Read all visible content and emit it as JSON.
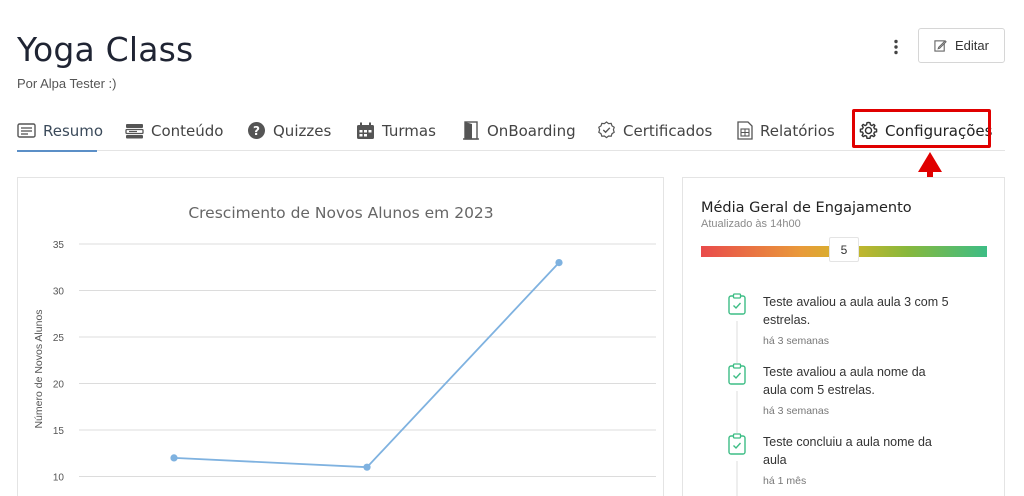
{
  "header": {
    "title": "Yoga Class",
    "subtitle": "Por Alpa Tester :)",
    "edit_label": "Editar"
  },
  "tabs": [
    {
      "label": "Resumo",
      "icon": "document-lines-icon",
      "active": true
    },
    {
      "label": "Conteúdo",
      "icon": "server-icon",
      "active": false
    },
    {
      "label": "Quizzes",
      "icon": "question-circle-icon",
      "active": false
    },
    {
      "label": "Turmas",
      "icon": "calendar-icon",
      "active": false
    },
    {
      "label": "OnBoarding",
      "icon": "door-icon",
      "active": false
    },
    {
      "label": "Certificados",
      "icon": "seal-check-icon",
      "active": false
    },
    {
      "label": "Relatórios",
      "icon": "spreadsheet-icon",
      "active": false
    },
    {
      "label": "Configurações",
      "icon": "gear-icon",
      "active": false
    }
  ],
  "colors": {
    "accent": "#5b8fc7",
    "highlight": "#e00000",
    "line_series": "#7fb2e0",
    "timeline_icon": "#3dbd85"
  },
  "chart_data": {
    "type": "line",
    "title": "Crescimento de Novos Alunos em 2023",
    "ylabel": "Número de Novos Alunos",
    "xlabel": "",
    "ylim": [
      8,
      35
    ],
    "yticks": [
      10,
      15,
      20,
      25,
      30,
      35
    ],
    "grid": true,
    "series": [
      {
        "values": [
          12,
          11,
          33
        ]
      }
    ]
  },
  "engagement": {
    "title": "Média Geral de Engajamento",
    "updated": "Atualizado às 14h00",
    "score": "5",
    "activities": [
      {
        "text": "Teste avaliou a aula aula 3 com 5 estrelas.",
        "time": "há 3 semanas"
      },
      {
        "text": "Teste avaliou a aula nome da aula com 5 estrelas.",
        "time": "há 3 semanas"
      },
      {
        "text": "Teste concluiu a aula nome da aula",
        "time": "há 1 mês"
      }
    ]
  }
}
